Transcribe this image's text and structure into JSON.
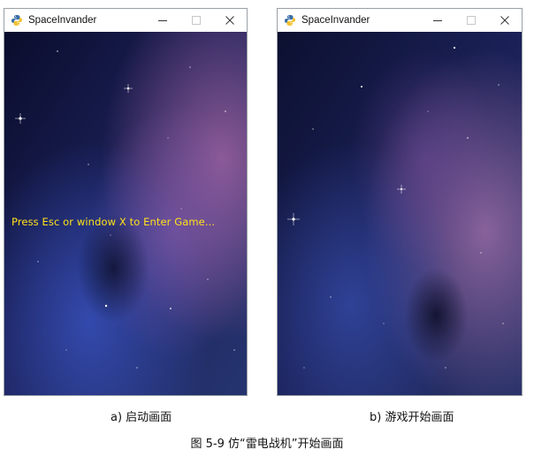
{
  "windows": [
    {
      "title": "SpaceInvander",
      "overlay_text": "Press Esc or window X to Enter Game...",
      "caption": "a)  启动画面"
    },
    {
      "title": "SpaceInvander",
      "caption": "b)  游戏开始画面"
    }
  ],
  "figure_caption": "图 5-9  仿“雷电战机”开始画面",
  "colors": {
    "overlay_text": "#ffe21a",
    "space_dark": "#0b0f2e",
    "nebula_purple": "#6a3f8f",
    "nebula_blue": "#2a3a8a"
  },
  "icons": [
    "python-icon",
    "minimize-icon",
    "maximize-icon",
    "close-icon"
  ]
}
